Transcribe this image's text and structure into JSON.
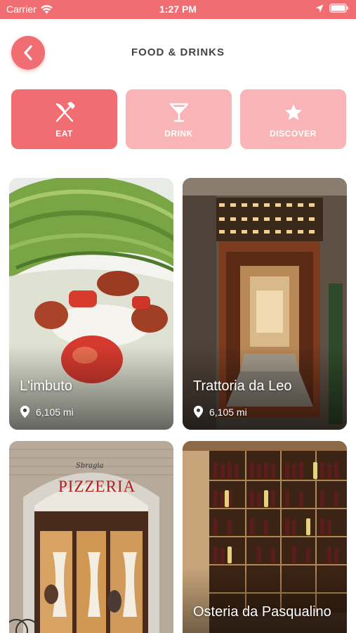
{
  "status_bar": {
    "carrier": "Carrier",
    "time": "1:27 PM"
  },
  "header": {
    "title": "FOOD & DRINKS"
  },
  "tabs": [
    {
      "label": "EAT",
      "icon": "fork-knife-icon",
      "active": true
    },
    {
      "label": "DRINK",
      "icon": "cocktail-icon",
      "active": false
    },
    {
      "label": "DISCOVER",
      "icon": "star-icon",
      "active": false
    }
  ],
  "places": [
    {
      "name": "L'imbuto",
      "distance": "6,105 mi"
    },
    {
      "name": "Trattoria da Leo",
      "distance": "6,105 mi"
    },
    {
      "name": "",
      "sign": "PIZZERIA",
      "sign_top": "Sbragia"
    },
    {
      "name": "Osteria da Pasqualino"
    }
  ],
  "colors": {
    "accent": "#f06e72",
    "accent_light": "#f8b4b6"
  }
}
